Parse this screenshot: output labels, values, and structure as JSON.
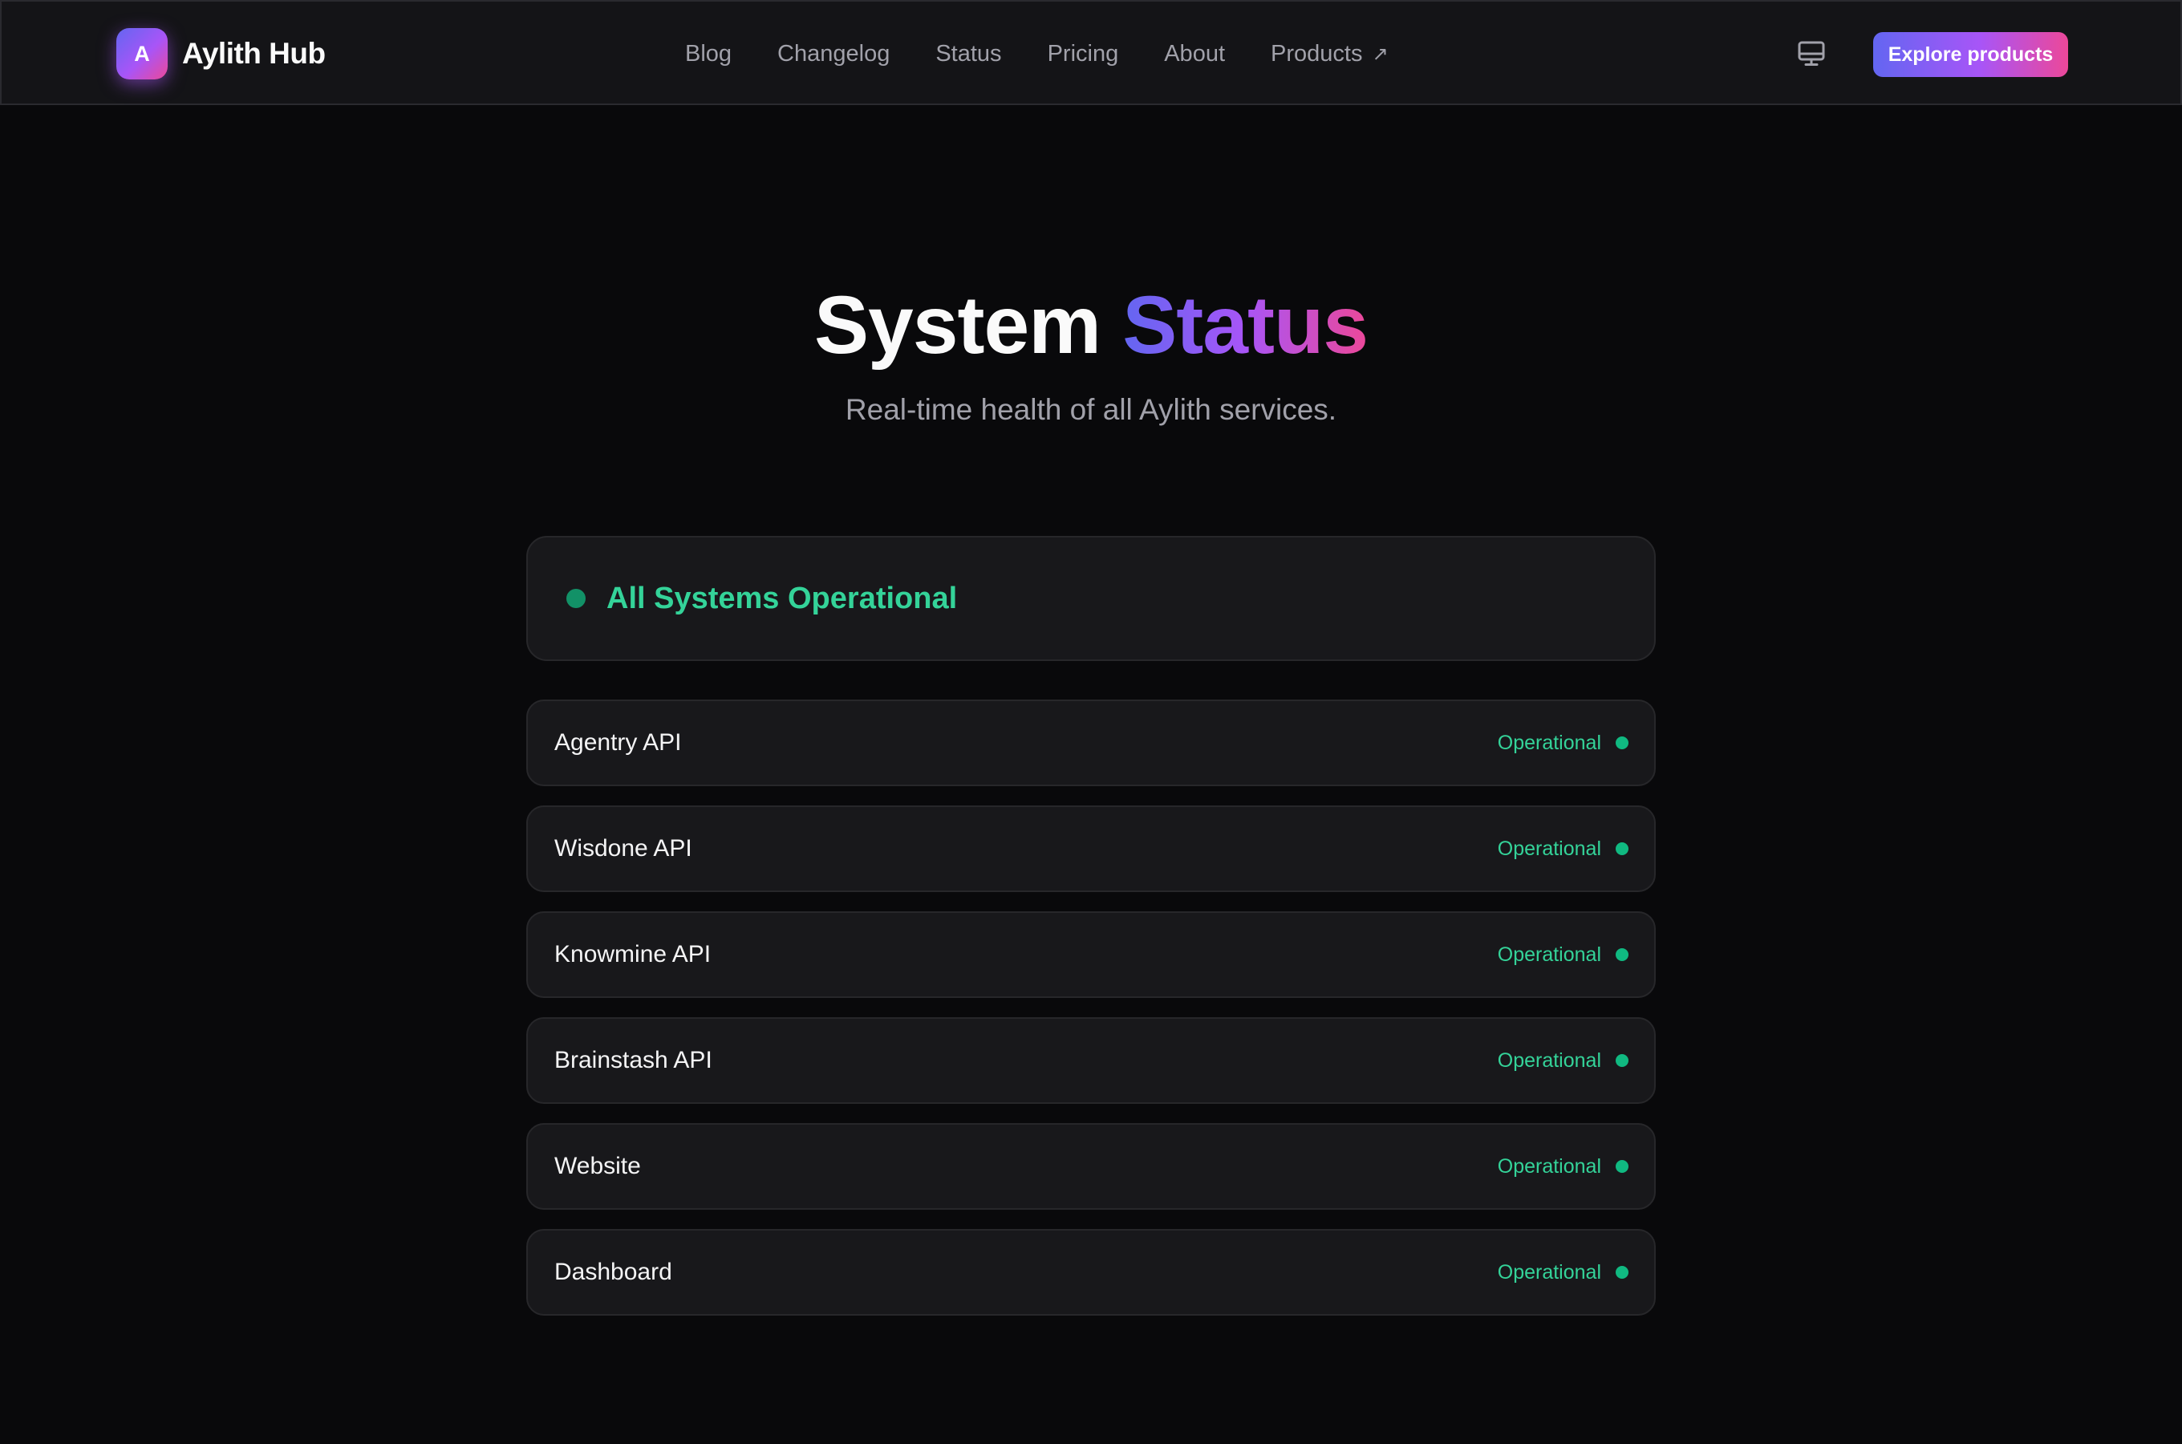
{
  "brand": {
    "logo_letter": "A",
    "name": "Aylith Hub"
  },
  "nav": {
    "links": [
      "Blog",
      "Changelog",
      "Status",
      "Pricing",
      "About"
    ],
    "products_label": "Products",
    "products_icon": "external-arrow-icon"
  },
  "header": {
    "theme_icon": "monitor-icon",
    "cta_label": "Explore products"
  },
  "hero": {
    "title_plain": "System",
    "title_accent": "Status",
    "subtitle": "Real-time health of all Aylith services."
  },
  "summary": {
    "text": "All Systems Operational"
  },
  "services": [
    {
      "name": "Agentry API",
      "status": "Operational"
    },
    {
      "name": "Wisdone API",
      "status": "Operational"
    },
    {
      "name": "Knowmine API",
      "status": "Operational"
    },
    {
      "name": "Brainstash API",
      "status": "Operational"
    },
    {
      "name": "Website",
      "status": "Operational"
    },
    {
      "name": "Dashboard",
      "status": "Operational"
    }
  ],
  "colors": {
    "background": "#09090b",
    "card": "#18181b",
    "operational": "#34d399",
    "accent_start": "#6366f1",
    "accent_mid": "#a855f7",
    "accent_end": "#ec4899"
  }
}
